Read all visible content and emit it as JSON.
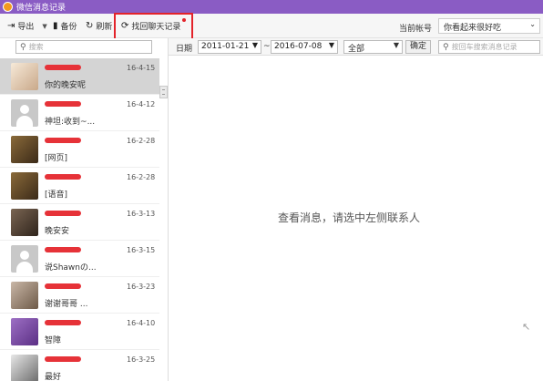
{
  "window": {
    "title": "微信消息记录"
  },
  "toolbar": {
    "export_label": "导出",
    "backup_label": "备份",
    "refresh_label": "刷新",
    "recover_label": "找回聊天记录",
    "account_label": "当前帐号",
    "account_value": "你看起来很好吃"
  },
  "left": {
    "search_placeholder": "搜索",
    "contacts": [
      {
        "date": "16-4-15",
        "msg": "你的晚安呢",
        "avatar": "photo-cartoon"
      },
      {
        "date": "16-4-12",
        "msg": "神坦:收到~...",
        "avatar": "default"
      },
      {
        "date": "16-2-28",
        "msg": "[网页]",
        "avatar": "photo-dark"
      },
      {
        "date": "16-2-28",
        "msg": "[语音]",
        "avatar": "photo-dark"
      },
      {
        "date": "16-3-13",
        "msg": "晚安安",
        "avatar": "photo-girl"
      },
      {
        "date": "16-3-15",
        "msg": "说Shawnの...",
        "avatar": "default"
      },
      {
        "date": "16-3-23",
        "msg": "谢谢哥哥 ...",
        "avatar": "photo-group"
      },
      {
        "date": "16-4-10",
        "msg": "智障",
        "avatar": "photo-purple"
      },
      {
        "date": "16-3-25",
        "msg": "最好",
        "avatar": "photo-man"
      }
    ]
  },
  "filter": {
    "date_label": "日期",
    "start_date": "2011-01-21",
    "separator": "~",
    "end_date": "2016-07-08",
    "type_value": "全部",
    "confirm_label": "确定",
    "search_placeholder": "按回车搜索消息记录"
  },
  "main": {
    "empty_text": "查看消息，请选中左侧联系人"
  }
}
